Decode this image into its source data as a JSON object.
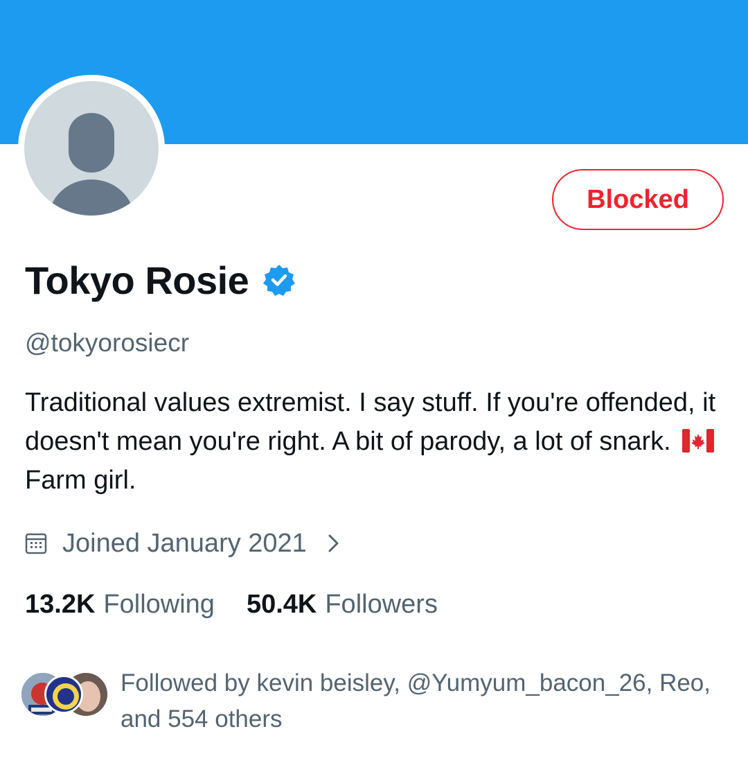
{
  "colors": {
    "banner": "#1d9bf0",
    "blocked": "#f4212e",
    "verified": "#1d9bf0",
    "secondary_text": "#536471",
    "primary_text": "#0f1419"
  },
  "profile": {
    "blocked_label": "Blocked",
    "display_name": "Tokyo Rosie",
    "handle": "@tokyorosiecr",
    "bio_part1": "Traditional values extremist. I say stuff. If you're offended, it doesn't mean you're right. A bit of parody, a lot of snark.",
    "bio_part2": "Farm girl.",
    "joined": "Joined January 2021",
    "following_count": "13.2K",
    "following_label": "Following",
    "followers_count": "50.4K",
    "followers_label": "Followers",
    "followed_by": "Followed by kevin beisley, @Yumyum_bacon_26, Reo, and 554 others"
  },
  "icons": {
    "verified": "verified-badge-icon",
    "calendar": "calendar-icon",
    "chevron": "chevron-right-icon",
    "flag": "canada-flag-icon"
  }
}
